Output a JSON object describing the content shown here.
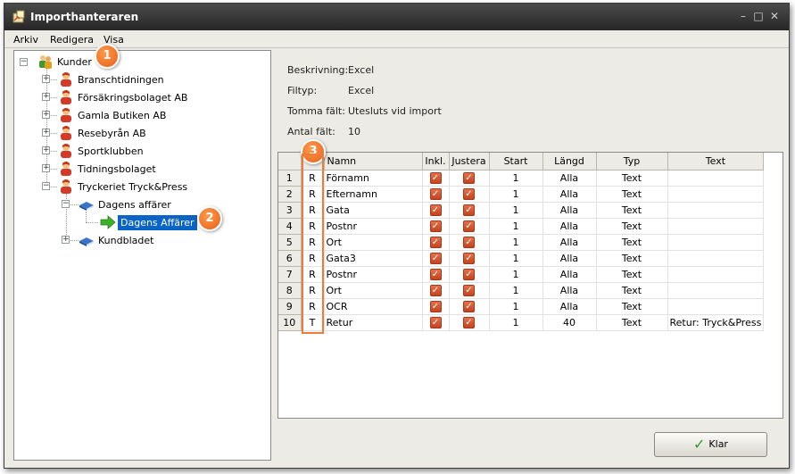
{
  "window": {
    "title": "Importhanteraren"
  },
  "menu": [
    "Arkiv",
    "Redigera",
    "Visa"
  ],
  "tree": {
    "root": "Kunder",
    "customers": [
      "Branschtidningen",
      "Försäkringsbolaget AB",
      "Gamla Butiken AB",
      "Resebyrån AB",
      "Sportklubben",
      "Tidningsbolaget",
      "Tryckeriet Tryck&Press"
    ],
    "sub_folders": [
      "Dagens affärer",
      "Kundbladet"
    ],
    "selected_item": "Dagens Affärer"
  },
  "info": [
    {
      "label": "Beskrivning:",
      "value": "Excel"
    },
    {
      "label": "Filtyp:",
      "value": "Excel"
    },
    {
      "label": "Tomma fält:",
      "value": "Utesluts vid import"
    },
    {
      "label": "Antal fält:",
      "value": "10"
    }
  ],
  "grid": {
    "headers": [
      "",
      "",
      "Namn",
      "Inkl.",
      "Justera",
      "Start",
      "Längd",
      "Typ",
      "Text"
    ],
    "rows": [
      [
        "1",
        "R",
        "Förnamn",
        true,
        true,
        "1",
        "Alla",
        "Text",
        ""
      ],
      [
        "2",
        "R",
        "Efternamn",
        true,
        true,
        "1",
        "Alla",
        "Text",
        ""
      ],
      [
        "3",
        "R",
        "Gata",
        true,
        true,
        "1",
        "Alla",
        "Text",
        ""
      ],
      [
        "4",
        "R",
        "Postnr",
        true,
        true,
        "1",
        "Alla",
        "Text",
        ""
      ],
      [
        "5",
        "R",
        "Ort",
        true,
        true,
        "1",
        "Alla",
        "Text",
        ""
      ],
      [
        "6",
        "R",
        "Gata3",
        true,
        true,
        "1",
        "Alla",
        "Text",
        ""
      ],
      [
        "7",
        "R",
        "Postnr",
        true,
        true,
        "1",
        "Alla",
        "Text",
        ""
      ],
      [
        "8",
        "R",
        "Ort",
        true,
        true,
        "1",
        "Alla",
        "Text",
        ""
      ],
      [
        "9",
        "R",
        "OCR",
        true,
        true,
        "1",
        "Alla",
        "Text",
        ""
      ],
      [
        "10",
        "T",
        "Retur",
        true,
        true,
        "1",
        "40",
        "Text",
        "Retur: Tryck&Press"
      ]
    ]
  },
  "button": {
    "ok_label": "Klar"
  },
  "callouts": [
    "1",
    "2",
    "3"
  ],
  "colors": {
    "accent": "#f07a3a",
    "selection": "#0a64c8",
    "titlebar": "#2e2e2e"
  }
}
